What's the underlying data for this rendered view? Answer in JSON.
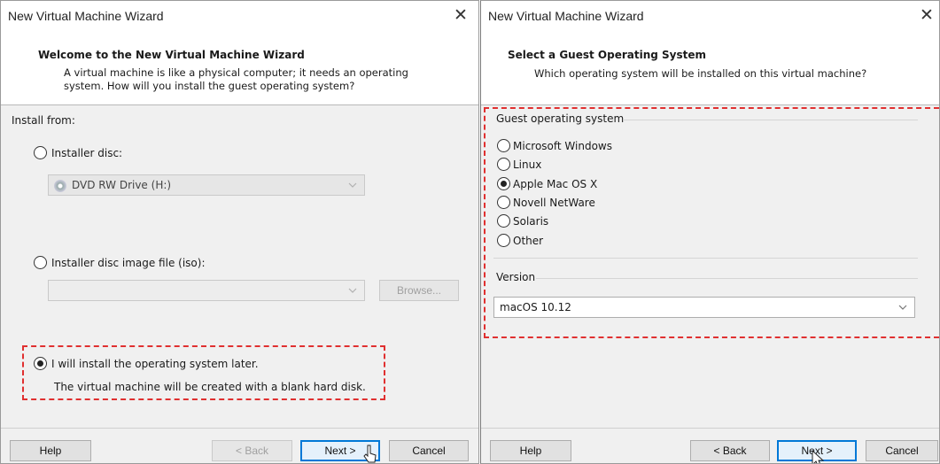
{
  "left": {
    "title": "New Virtual Machine Wizard",
    "header_title": "Welcome to the New Virtual Machine Wizard",
    "header_desc_line1": "A virtual machine is like a physical computer; it needs an operating",
    "header_desc_line2": "system. How will you install the guest operating system?",
    "install_from": "Install from:",
    "options": {
      "disc": "Installer disc:",
      "iso": "Installer disc image file (iso):",
      "later": "I will install the operating system later."
    },
    "disc_drive": "DVD RW Drive (H:)",
    "iso_path": "",
    "browse": "Browse...",
    "later_note": "The virtual machine will be created with a blank hard disk.",
    "selected": "later",
    "buttons": {
      "help": "Help",
      "back": "< Back",
      "next": "Next >",
      "cancel": "Cancel"
    }
  },
  "right": {
    "title": "New Virtual Machine Wizard",
    "header_title": "Select a Guest Operating System",
    "header_desc": "Which operating system will be installed on this virtual machine?",
    "group_label": "Guest operating system",
    "os_options": [
      "Microsoft Windows",
      "Linux",
      "Apple Mac OS X",
      "Novell NetWare",
      "Solaris",
      "Other"
    ],
    "selected_os": "Apple Mac OS X",
    "version_label": "Version",
    "version_value": "macOS 10.12",
    "buttons": {
      "help": "Help",
      "back": "< Back",
      "next": "Next >",
      "cancel": "Cancel"
    }
  },
  "colors": {
    "highlight_dash": "#e03030",
    "focus": "#0078d7"
  }
}
